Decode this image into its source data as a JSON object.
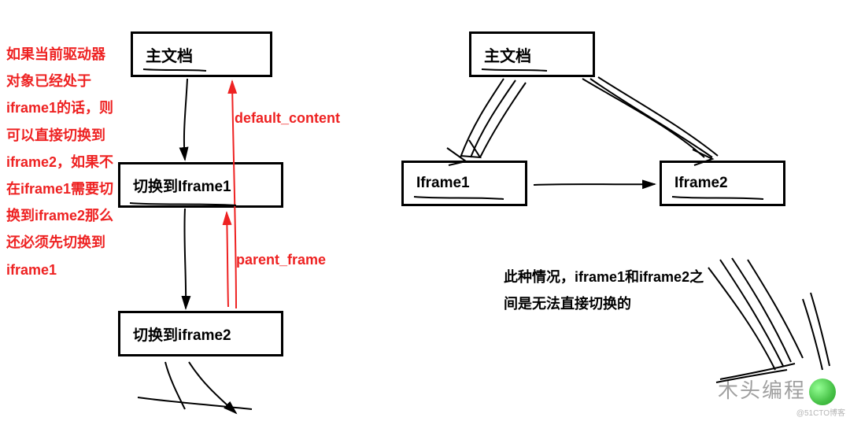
{
  "left_diagram": {
    "note": "如果当前驱动器对象已经处于iframe1的话，则可以直接切换到iframe2，如果不在iframe1需要切换到iframe2那么还必须先切换到iframe1",
    "boxes": {
      "main": "主文档",
      "frame1": "切换到Iframe1",
      "frame2": "切换到iframe2"
    },
    "arrow_labels": {
      "default_content": "default_content",
      "parent_frame": "parent_frame"
    }
  },
  "right_diagram": {
    "boxes": {
      "main": "主文档",
      "frame1": "Iframe1",
      "frame2": "Iframe2"
    },
    "note": "此种情况，iframe1和iframe2之间是无法直接切换的"
  },
  "watermark": {
    "text": "木头编程",
    "site": "@51CTO博客"
  }
}
